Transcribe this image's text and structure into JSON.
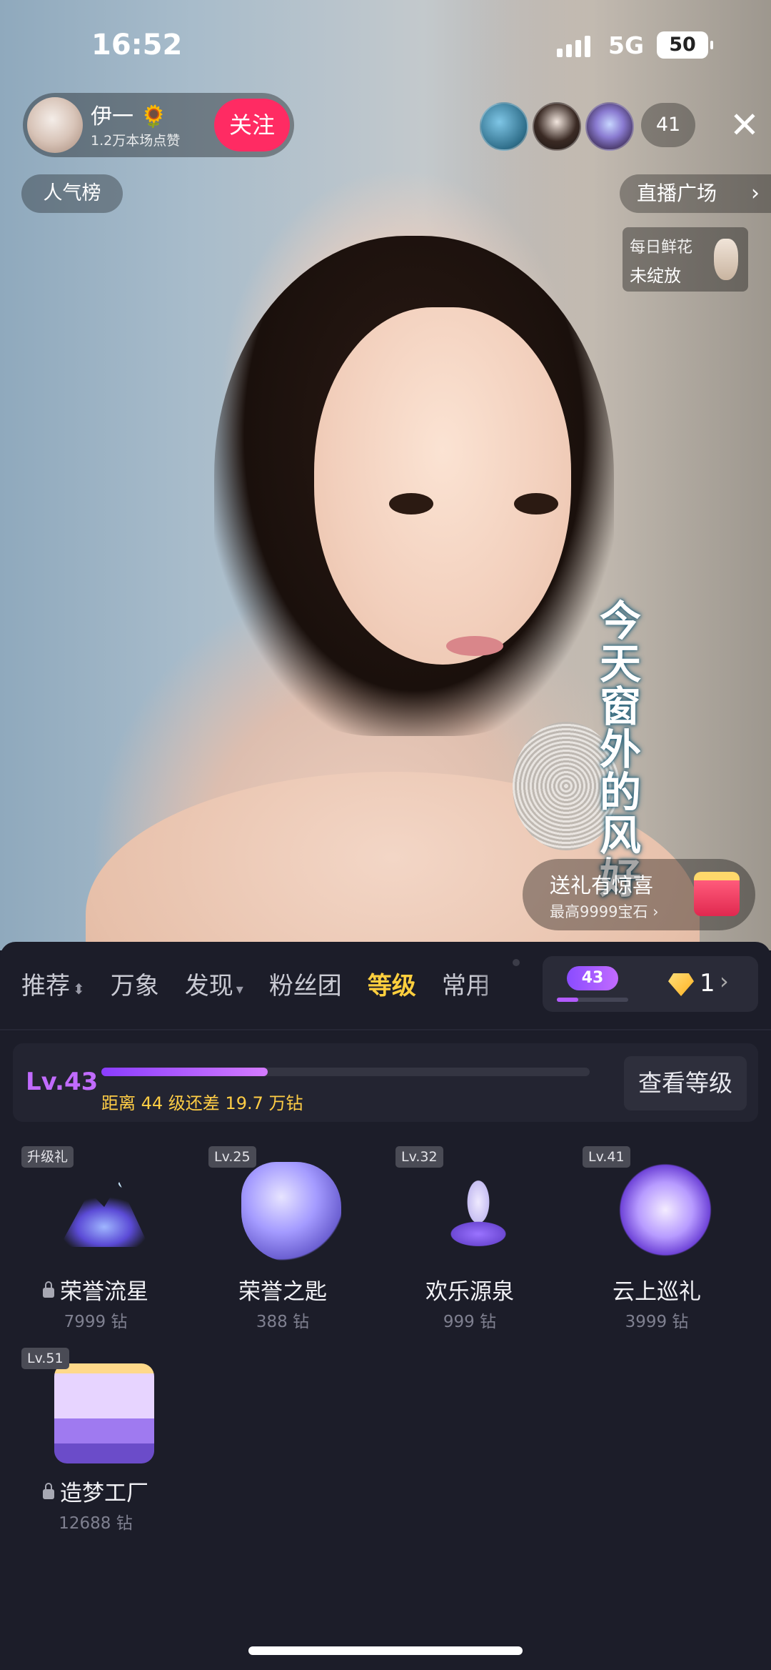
{
  "status_bar": {
    "time": "16:52",
    "network": "5G",
    "battery": "50"
  },
  "host": {
    "name": "伊一 🌻",
    "likes": "1.2万本场点赞",
    "follow_label": "关注"
  },
  "viewers": {
    "count": "41"
  },
  "buttons": {
    "popularity_rank": "人气榜",
    "live_plaza": "直播广场"
  },
  "daily_flower": {
    "line1": "每日鲜花",
    "line2": "未绽放"
  },
  "lyrics": "今天窗外的风好",
  "promo": {
    "title": "送礼有惊喜",
    "subtitle": "最高9999宝石 ›"
  },
  "gift_panel": {
    "tabs": [
      "推荐",
      "万象",
      "发现",
      "粉丝团",
      "等级",
      "常用"
    ],
    "active_tab": "等级",
    "wallet": {
      "level": "43",
      "level_progress": 0.3,
      "diamonds": "1"
    },
    "level_card": {
      "level": "Lv.43",
      "progress": 0.34,
      "hint": "距离 44 级还差 19.7 万钻",
      "view_button": "查看等级"
    },
    "gifts": [
      {
        "badge": "升级礼",
        "name": "荣誉流星",
        "price": "7999 钻",
        "locked": true
      },
      {
        "badge": "Lv.25",
        "name": "荣誉之匙",
        "price": "388 钻",
        "locked": false
      },
      {
        "badge": "Lv.32",
        "name": "欢乐源泉",
        "price": "999 钻",
        "locked": false
      },
      {
        "badge": "Lv.41",
        "name": "云上巡礼",
        "price": "3999 钻",
        "locked": false
      },
      {
        "badge": "Lv.51",
        "name": "造梦工厂",
        "price": "12688 钻",
        "locked": true
      }
    ]
  },
  "colors": {
    "accent_pink": "#ff2b63",
    "level_purple": "#c16bff",
    "tab_active": "#ffcf3e",
    "panel_bg": "#1c1d29"
  }
}
